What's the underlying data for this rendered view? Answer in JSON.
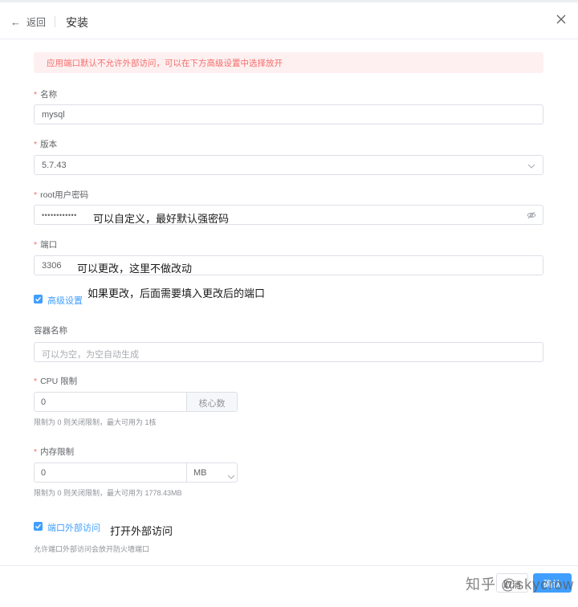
{
  "header": {
    "back_label": "返回",
    "title": "安装"
  },
  "alert": {
    "text": "应用端口默认不允许外部访问，可以在下方高级设置中选择放开"
  },
  "form": {
    "name": {
      "label": "名称",
      "value": "mysql"
    },
    "version": {
      "label": "版本",
      "value": "5.7.43"
    },
    "root_password": {
      "label": "root用户密码",
      "value": "••••••••••••"
    },
    "port": {
      "label": "端口",
      "value": "3306"
    },
    "advanced": {
      "label": "高级设置",
      "checked": true
    },
    "container_name": {
      "label": "容器名称",
      "placeholder": "可以为空，为空自动生成"
    },
    "cpu_limit": {
      "label": "CPU 限制",
      "value": "0",
      "unit": "核心数",
      "hint": "限制为 0 则关闭限制，最大可用为 1核"
    },
    "memory_limit": {
      "label": "内存限制",
      "value": "0",
      "unit": "MB",
      "hint": "限制为 0 则关闭限制，最大可用为 1778.43MB"
    },
    "external_access": {
      "label": "端口外部访问",
      "checked": true,
      "hint": "允许端口外部访问会放开防火墙端口"
    }
  },
  "annotations": {
    "password": "可以自定义，最好默认强密码",
    "port": "可以更改，这里不做改动",
    "advanced": "如果更改，后面需要填入更改后的端口",
    "external": "打开外部访问"
  },
  "footer": {
    "cancel_label": "取消",
    "confirm_label": "确认",
    "watermark": "知乎 @skycrow"
  },
  "colors": {
    "primary": "#409eff",
    "danger": "#f56c6c",
    "alert_bg": "#fef0f0",
    "border": "#dcdfe6"
  },
  "icons": {
    "back": "arrow-left-icon",
    "close": "close-icon",
    "select": "chevron-down-icon",
    "password_toggle": "eye-icon",
    "checkbox": "check-icon"
  }
}
